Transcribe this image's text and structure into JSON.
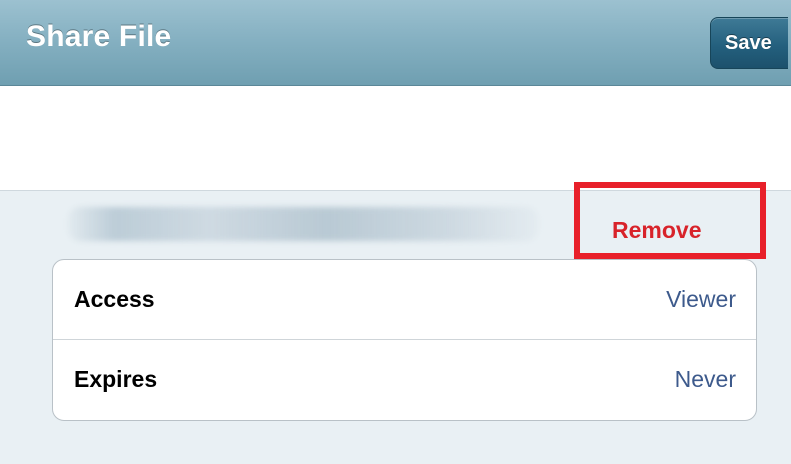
{
  "navbar": {
    "title": "Share File",
    "save_label": "Save"
  },
  "recipient": {
    "remove_label": "Remove"
  },
  "settings": {
    "rows": [
      {
        "label": "Access",
        "value": "Viewer"
      },
      {
        "label": "Expires",
        "value": "Never"
      }
    ]
  },
  "colors": {
    "navbar_bg": "#86b1c2",
    "save_button_bg": "#24607e",
    "remove_text": "#d8232a",
    "highlight_box": "#e8202a",
    "panel_bg": "#e9f0f4",
    "value_text": "#3d5a8c"
  }
}
